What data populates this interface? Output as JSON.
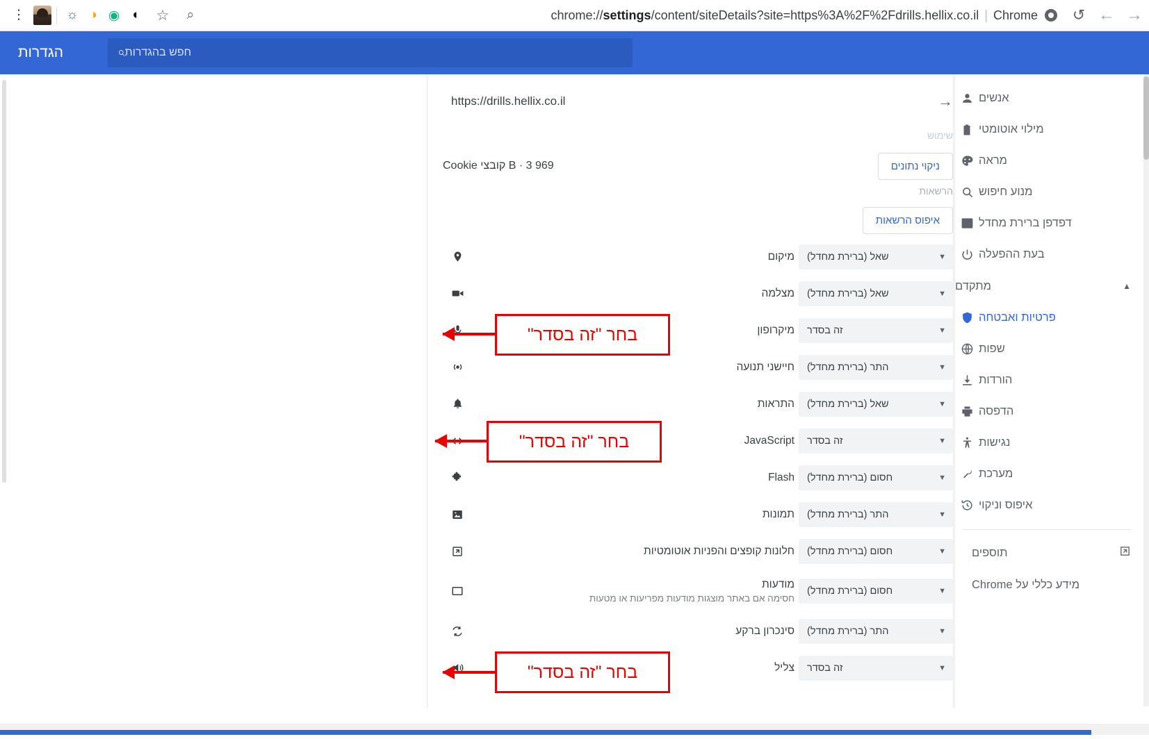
{
  "browser": {
    "menu_icon": "three-dots-icon",
    "avatar": "profile-avatar",
    "extensions": [
      {
        "name": "extension-icon-1",
        "glyph": "●●"
      },
      {
        "name": "extension-icon-2",
        "glyph": "◑"
      },
      {
        "name": "extension-icon-3",
        "glyph": "G"
      },
      {
        "name": "extension-icon-4",
        "glyph": "◖"
      }
    ],
    "bookmark_star": "☆",
    "zoom_glyph": "⌕",
    "url_prefix": "chrome://",
    "url_bold": "settings",
    "url_suffix": "/content/siteDetails?site=https%3A%2F%2Fdrills.hellix.co.il",
    "url_divider": "|",
    "profile_name": "Chrome",
    "reload_glyph": "↺",
    "back_glyph": "←",
    "forward_glyph": "→"
  },
  "header": {
    "title": "הגדרות",
    "search_placeholder": "חפש בהגדרות",
    "search_icon": "⌕",
    "accent_color": "#3367d6"
  },
  "sidebar": {
    "items": [
      {
        "label": "אנשים",
        "icon": "person-icon",
        "glyph": "●",
        "active": false
      },
      {
        "label": "מילוי אוטומטי",
        "icon": "clipboard-icon",
        "glyph": "▤",
        "active": false
      },
      {
        "label": "מראה",
        "icon": "palette-icon",
        "glyph": "◕",
        "active": false
      },
      {
        "label": "מנוע חיפוש",
        "icon": "search-icon",
        "glyph": "⌕",
        "active": false
      },
      {
        "label": "דפדפן ברירת מחדל",
        "icon": "browser-window-icon",
        "glyph": "▥",
        "active": false
      },
      {
        "label": "בעת ההפעלה",
        "icon": "power-icon",
        "glyph": "⏻",
        "active": false
      }
    ],
    "advanced": {
      "label": "מתקדם",
      "caret": "▲"
    },
    "advanced_items": [
      {
        "label": "פרטיות ואבטחה",
        "icon": "shield-icon",
        "glyph": "⛨",
        "active": true
      },
      {
        "label": "שפות",
        "icon": "globe-icon",
        "glyph": "⊕",
        "active": false
      },
      {
        "label": "הורדות",
        "icon": "download-icon",
        "glyph": "⬇",
        "active": false
      },
      {
        "label": "הדפסה",
        "icon": "printer-icon",
        "glyph": "⎙",
        "active": false
      },
      {
        "label": "נגישות",
        "icon": "accessibility-icon",
        "glyph": "Ɣ",
        "active": false
      },
      {
        "label": "מערכת",
        "icon": "wrench-icon",
        "glyph": "⚒",
        "active": false
      },
      {
        "label": "איפוס וניקוי",
        "icon": "history-restore-icon",
        "glyph": "↺",
        "active": false
      }
    ],
    "extensions_row": {
      "label": "תוספים",
      "icon": "external-link-icon",
      "glyph": "↗"
    },
    "about_row": {
      "label": "מידע כללי על Chrome"
    }
  },
  "main": {
    "site_url": "https://drills.hellix.co.il",
    "site_arrow": "→",
    "usage_heading": "שימוש",
    "usage_value": "969 B · 3 קובצי Cookie",
    "clear_data_button": "ניקוי נתונים",
    "permissions_heading": "הרשאות",
    "reset_permissions_button": "איפוס הרשאות",
    "caret": "▼",
    "permissions": [
      {
        "name": "מיקום",
        "sub": "",
        "value": "שאל (ברירת מחדל)",
        "icon": "location-pin-icon",
        "glyph": "◉"
      },
      {
        "name": "מצלמה",
        "sub": "",
        "value": "שאל (ברירת מחדל)",
        "icon": "camera-icon",
        "glyph": "▬"
      },
      {
        "name": "מיקרופון",
        "sub": "",
        "value": "זה בסדר",
        "icon": "microphone-icon",
        "glyph": "⏺"
      },
      {
        "name": "חיישני תנועה",
        "sub": "",
        "value": "התר (ברירת מחדל)",
        "icon": "motion-sensor-icon",
        "glyph": "((•))"
      },
      {
        "name": "התראות",
        "sub": "",
        "value": "שאל (ברירת מחדל)",
        "icon": "bell-icon",
        "glyph": "▲"
      },
      {
        "name": "JavaScript",
        "sub": "",
        "value": "זה בסדר",
        "icon": "code-brackets-icon",
        "glyph": "< >"
      },
      {
        "name": "Flash",
        "sub": "",
        "value": "חסום (ברירת מחדל)",
        "icon": "puzzle-piece-icon",
        "glyph": "❖"
      },
      {
        "name": "תמונות",
        "sub": "",
        "value": "התר (ברירת מחדל)",
        "icon": "image-icon",
        "glyph": "▣"
      },
      {
        "name": "חלונות קופצים והפניות אוטומטיות",
        "sub": "",
        "value": "חסום (ברירת מחדל)",
        "icon": "popup-window-icon",
        "glyph": "↗"
      },
      {
        "name": "מודעות",
        "sub": "חסימה אם באתר מוצגות מודעות מפריעות או מטעות",
        "value": "חסום (ברירת מחדל)",
        "icon": "ads-rectangle-icon",
        "glyph": "▭"
      },
      {
        "name": "סינכרון ברקע",
        "sub": "",
        "value": "התר (ברירת מחדל)",
        "icon": "sync-icon",
        "glyph": "↻"
      },
      {
        "name": "צליל",
        "sub": "",
        "value": "זה בסדר",
        "icon": "sound-speaker-icon",
        "glyph": "◀"
      }
    ]
  },
  "annotations": {
    "color": "#e60000",
    "items": [
      {
        "text": "בחר \"זה בסדר\"",
        "target": "microphone"
      },
      {
        "text": "בחר \"זה בסדר\"",
        "target": "javascript"
      },
      {
        "text": "בחר \"זה בסדר\"",
        "target": "sound"
      }
    ]
  }
}
